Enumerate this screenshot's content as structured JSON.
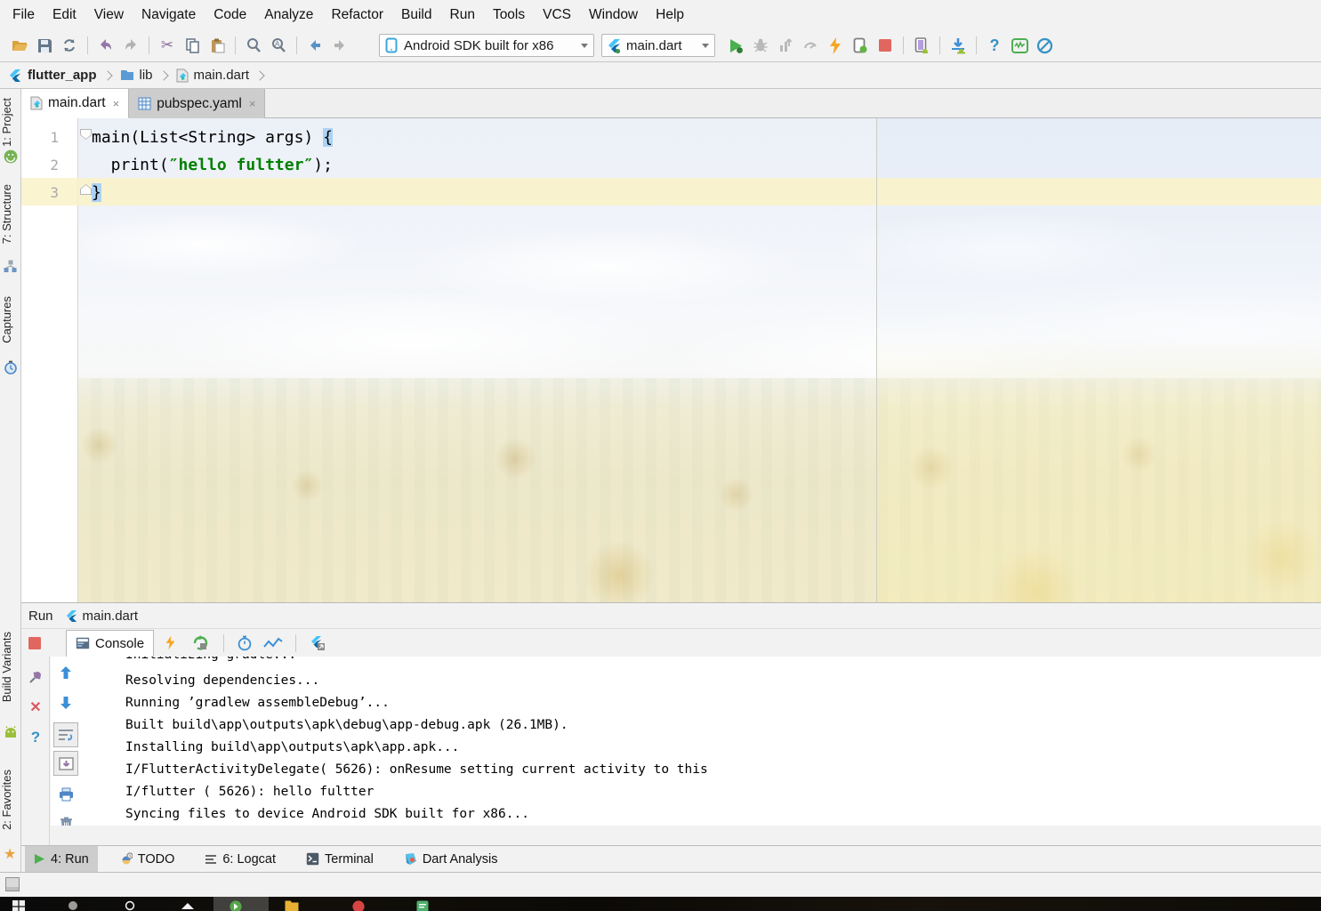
{
  "menu": {
    "items": [
      "File",
      "Edit",
      "View",
      "Navigate",
      "Code",
      "Analyze",
      "Refactor",
      "Build",
      "Run",
      "Tools",
      "VCS",
      "Window",
      "Help"
    ]
  },
  "toolbar": {
    "device_selector": "Android SDK built for x86",
    "config_selector": "main.dart",
    "icons": [
      "open-folder-icon",
      "save-icon",
      "sync-icon",
      "undo-icon",
      "redo-icon",
      "cut-icon",
      "copy-icon",
      "paste-icon",
      "find-icon",
      "replace-icon",
      "back-icon",
      "forward-icon",
      "run-icon",
      "debug-icon",
      "profile-icon",
      "coverage-icon",
      "hot-reload-icon",
      "attach-debugger-icon",
      "stop-icon",
      "layout-inspector-icon",
      "sdk-manager-icon",
      "help-icon",
      "android-monitor-icon",
      "no-entry-icon"
    ]
  },
  "breadcrumb": {
    "items": [
      "flutter_app",
      "lib",
      "main.dart"
    ]
  },
  "tabs": [
    {
      "label": "main.dart",
      "close": "×"
    },
    {
      "label": "pubspec.yaml",
      "close": "×"
    }
  ],
  "editor": {
    "lines": [
      {
        "number": "1",
        "code": "main(List<String> args) ",
        "brace": "{"
      },
      {
        "number": "2",
        "code_pre": "  print(",
        "string": "″hello fultter″",
        "code_post": ");"
      },
      {
        "number": "3",
        "brace": "}"
      }
    ]
  },
  "stripe": {
    "items": [
      "1: Project",
      "7: Structure",
      "Captures",
      "Build Variants",
      "2: Favorites"
    ],
    "favorites_star": "★"
  },
  "run_panel": {
    "title": "Run",
    "config": "main.dart",
    "console_tab": "Console",
    "close_glyph": "✕",
    "help_glyph": "?",
    "console_lines": [
      "Initializing gradle...",
      "Resolving dependencies...",
      "Running ’gradlew assembleDebug’...",
      "Built build\\app\\outputs\\apk\\debug\\app-debug.apk (26.1MB).",
      "Installing build\\app\\outputs\\apk\\app.apk...",
      "I/FlutterActivityDelegate( 5626): onResume setting current activity to this",
      "I/flutter ( 5626): hello fultter",
      "Syncing files to device Android SDK built for x86..."
    ]
  },
  "bottom_bar": {
    "items": [
      "4: Run",
      "TODO",
      "6: Logcat",
      "Terminal",
      "Dart Analysis"
    ]
  },
  "help_glyph": "?",
  "colors": {
    "run_green": "#4caf50",
    "stop_red": "#e0675f",
    "hot_reload_orange": "#f5a623",
    "flutter_light_blue": "#45c4f8",
    "flutter_dark_blue": "#01579b",
    "string_green": "#008000",
    "brace_highlight": "#abd2f4",
    "current_line_yellow": "#faf2c8",
    "favorites_orange": "#e8a33d"
  }
}
